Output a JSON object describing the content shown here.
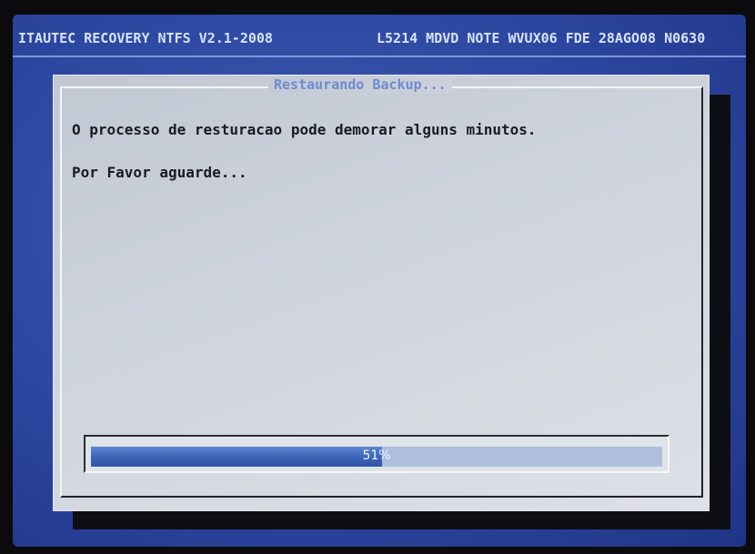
{
  "header": {
    "left": "ITAUTEC RECOVERY NTFS V2.1-2008",
    "right": "L5214 MDVD NOTE WVUX06 FDE 28AGO08 N0630"
  },
  "dialog": {
    "title": "Restaurando Backup...",
    "message_line1": "O processo de resturacao pode demorar alguns minutos.",
    "message_line2": "Por Favor aguarde..."
  },
  "progress": {
    "value": 51,
    "label": "51%"
  },
  "colors": {
    "screen": "#2c47a0",
    "dialog": "#cdd2db",
    "progress_fill": "#3c63b6",
    "title_text": "#6e8bd3"
  }
}
